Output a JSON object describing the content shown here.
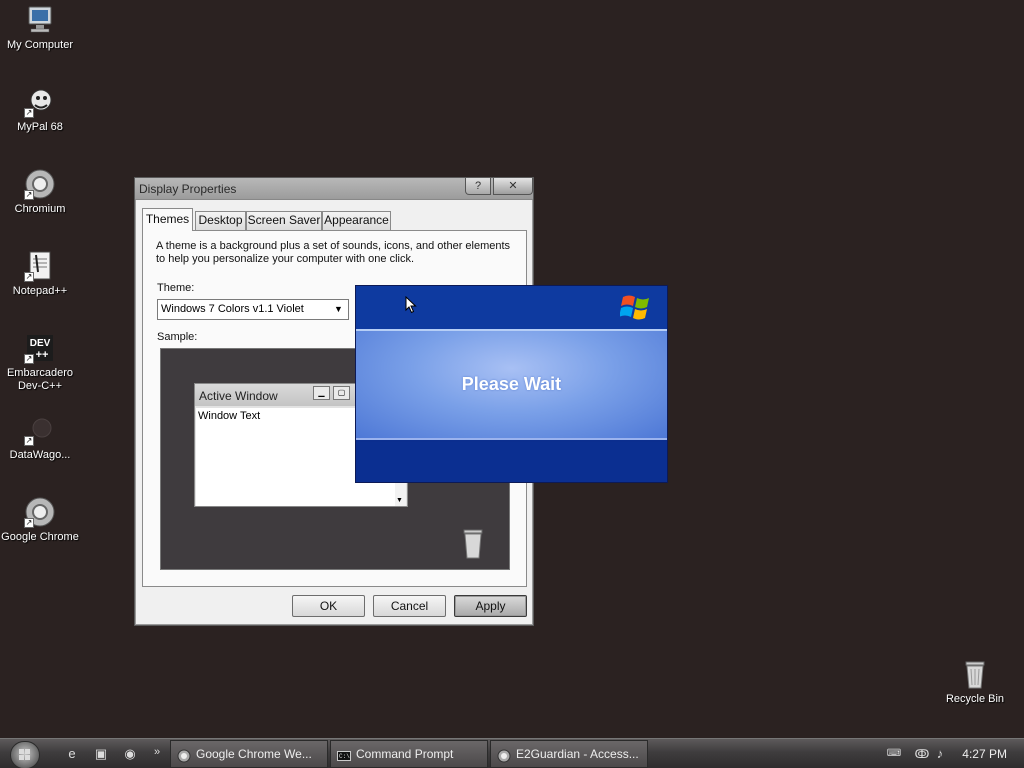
{
  "desktop": {
    "icons": [
      {
        "label": "My Computer"
      },
      {
        "label": "MyPal 68"
      },
      {
        "label": "Chromium"
      },
      {
        "label": "Notepad++"
      },
      {
        "label": "Embarcadero Dev-C++"
      },
      {
        "label": "DataWago..."
      },
      {
        "label": "Google Chrome"
      },
      {
        "label": "Recycle Bin"
      }
    ]
  },
  "dialog": {
    "title": "Display Properties",
    "help_glyph": "?",
    "close_glyph": "✕",
    "tabs": [
      {
        "label": "Themes"
      },
      {
        "label": "Desktop"
      },
      {
        "label": "Screen Saver"
      },
      {
        "label": "Appearance"
      }
    ],
    "description": "A theme is a background plus a set of sounds, icons, and other elements to help you personalize your computer with one click.",
    "theme_label": "Theme:",
    "theme_value": "Windows 7 Colors v1.1 Violet",
    "sample_label": "Sample:",
    "sample": {
      "window_title": "Active Window",
      "window_text": "Window Text"
    },
    "buttons": {
      "ok": "OK",
      "cancel": "Cancel",
      "apply": "Apply"
    }
  },
  "splash": {
    "text": "Please Wait"
  },
  "taskbar": {
    "more_glyph": "»",
    "tasks": [
      {
        "label": "Google Chrome We..."
      },
      {
        "label": "Command Prompt"
      },
      {
        "label": "E2Guardian - Access..."
      }
    ],
    "clock": "4:27 PM"
  },
  "colors": {
    "desktop": "#2b2221",
    "splash_blue": "#0b2e8f"
  }
}
